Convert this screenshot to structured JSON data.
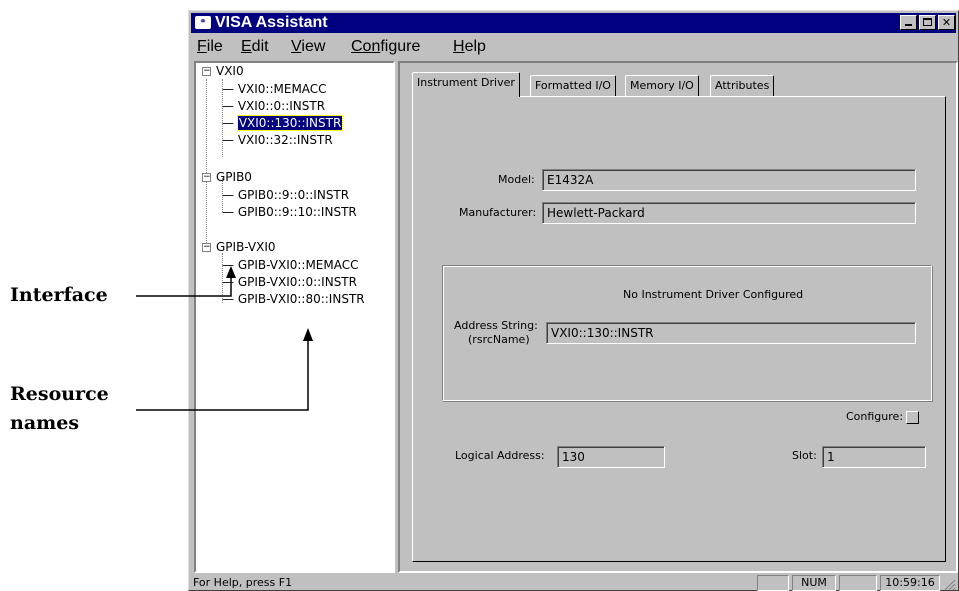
{
  "window": {
    "title": "VISA Assistant",
    "buttons": {
      "minimize": "minimize-icon",
      "maximize": "maximize-icon",
      "close": "close-icon"
    },
    "colors": {
      "titlebar": "#000080",
      "face": "#c0c0c0",
      "selection": "#000080"
    }
  },
  "menu": {
    "file": {
      "key": "F",
      "rest": "ile"
    },
    "edit": {
      "key": "E",
      "rest": "dit"
    },
    "view": {
      "key": "V",
      "rest": "iew"
    },
    "configure": {
      "key": "Con",
      "rest": "figure"
    },
    "help": {
      "key": "H",
      "rest": "elp"
    }
  },
  "tree": {
    "vxi0": "VXI0",
    "vxi0_memacc": "VXI0::MEMACC",
    "vxi0_0": "VXI0::0::INSTR",
    "vxi0_130": "VXI0::130::INSTR",
    "vxi0_32": "VXI0::32::INSTR",
    "gpib0": "GPIB0",
    "gpib0_9_0": "GPIB0::9::0::INSTR",
    "gpib0_9_10": "GPIB0::9::10::INSTR",
    "gpibvxi0": "GPIB-VXI0",
    "gpibvxi0_memacc": "GPIB-VXI0::MEMACC",
    "gpibvxi0_0": "GPIB-VXI0::0::INSTR",
    "gpibvxi0_80": "GPIB-VXI0::80::INSTR",
    "selected": "VXI0::130::INSTR"
  },
  "tabs": {
    "instrument_driver": "Instrument Driver",
    "formatted_io": "Formatted I/O",
    "memory_io": "Memory I/O",
    "attributes": "Attributes"
  },
  "form": {
    "model_label": "Model:",
    "model_value": "E1432A",
    "manufacturer_label": "Manufacturer:",
    "manufacturer_value": "Hewlett-Packard",
    "driver_status": "No Instrument Driver Configured",
    "address_label_1": "Address String:",
    "address_label_2": "(rsrcName)",
    "address_value": "VXI0::130::INSTR",
    "configure_label": "Configure:",
    "logical_address_label": "Logical Address:",
    "logical_address_value": "130",
    "slot_label": "Slot:",
    "slot_value": "1"
  },
  "status": {
    "help": "For Help, press F1",
    "num": "NUM",
    "time": "10:59:16"
  },
  "callouts": {
    "interface": "Interface",
    "resource_names_1": "Resource",
    "resource_names_2": "names"
  }
}
